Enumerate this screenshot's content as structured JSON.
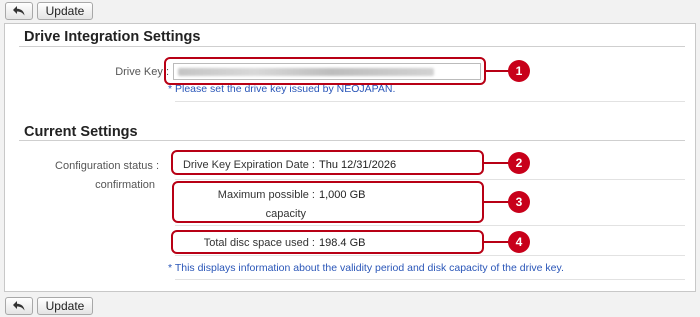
{
  "toolbar": {
    "back_icon": "back-arrow-icon",
    "update_label": "Update"
  },
  "drive_integration": {
    "title": "Drive Integration Settings",
    "drive_key_label": "Drive Key :",
    "drive_key_value": "",
    "note": "* Please set the drive key issued by NEOJAPAN."
  },
  "current_settings": {
    "title": "Current Settings",
    "status_label_line1": "Configuration status :",
    "status_label_line2": "confirmation",
    "expiration_label": "Drive Key Expiration Date :",
    "expiration_value": "Thu 12/31/2026",
    "max_capacity_label_line1": "Maximum possible :",
    "max_capacity_label_line2": "capacity",
    "max_capacity_value": "1,000 GB",
    "total_used_label": "Total disc space used :",
    "total_used_value": "198.4 GB",
    "note": "* This displays information about the validity period and disk capacity of the drive key."
  },
  "callouts": [
    "1",
    "2",
    "3",
    "4"
  ],
  "colors": {
    "callout": "#c8001a",
    "note": "#2a56b8"
  }
}
